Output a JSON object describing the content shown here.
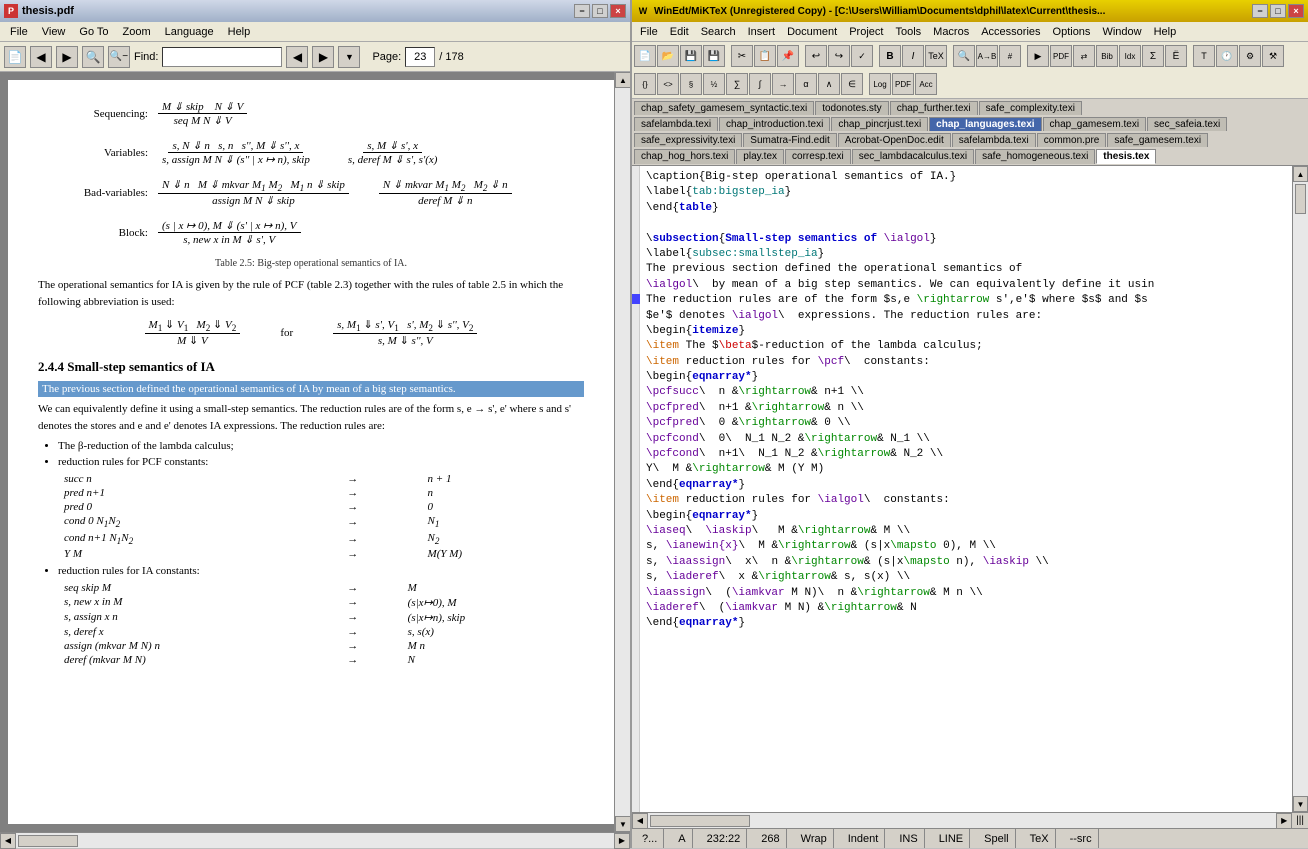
{
  "pdf": {
    "title": "thesis.pdf",
    "menu": [
      "File",
      "View",
      "Go To",
      "Zoom",
      "Language",
      "Help"
    ],
    "find_label": "Find:",
    "find_value": "",
    "page_current": "23",
    "page_total": "178",
    "window_controls": [
      "-",
      "□",
      "×"
    ],
    "caption": "Table 2.5: Big-step operational semantics of IA.",
    "body_text1": "The operational semantics for IA is given by the rule of PCF (table 2.3) together with the rules of table 2.5 in which the following abbreviation is used:",
    "section_heading": "2.4.4   Small-step semantics of IA",
    "highlight_text": "The previous section defined the operational semantics of IA by mean of a big step semantics.",
    "body_text2": "We can equivalently define it using a small-step semantics. The reduction rules are of the form s, e → s', e' where s and s' denotes the stores and e and e' denotes IA expressions. The reduction rules are:",
    "bullet1": "The β-reduction of the lambda calculus;",
    "bullet2": "reduction rules for PCF constants:",
    "bullet3": "reduction rules for IA constants:",
    "math_sequencing_top": "M ⇓ skip    N ⇓ V",
    "math_sequencing_bot": "seq M N ⇓ V",
    "math_var_top1": "s, N ⇓ n    s, n    s'',M ⇓ s'', x",
    "math_var_bot1": "s, assign M N ⇓ (s''|x ↦ n), skip",
    "math_var_top2": "s, M ⇓ s', x",
    "math_var_bot2": "s, deref M ⇓ s', s'(x)"
  },
  "editor": {
    "title": "WinEdt/MiKTeX (Unregistered Copy) - [C:\\Users\\William\\Documents\\dphil\\latex\\Current\\thesis...",
    "menu": [
      "File",
      "Edit",
      "Search",
      "Insert",
      "Document",
      "Project",
      "Tools",
      "Macros",
      "Accessories",
      "Options",
      "Window",
      "Help"
    ],
    "window_controls": [
      "-",
      "□",
      "×",
      "—",
      "□",
      "×"
    ],
    "tabs_row1": [
      "chap_safety_gamesem_syntactic.texi",
      "todonotes.sty",
      "chap_further.texi",
      "safe_complexity.texi"
    ],
    "tabs_row2": [
      "safelambda.texi",
      "chap_introduction.texi",
      "chap_pincrjust.texi",
      "chap_languages.texi",
      "chap_gamesem.texi",
      "sec_safeia.texi"
    ],
    "tabs_row3": [
      "safe_expressivity.texi",
      "Sumatra-Find.edit",
      "Acrobat-OpenDoc.edit",
      "safelambda.texi",
      "common.pre",
      "safe_gamesem.texi"
    ],
    "tabs_row4": [
      "chap_hog_hors.texi",
      "play.tex",
      "corresp.texi",
      "sec_lambdacalculus.texi",
      "safe_homogeneous.texi",
      "thesis.tex"
    ],
    "active_tab": "thesis.tex",
    "status_question": "?...",
    "status_col": "A",
    "status_pos": "232:22",
    "status_num": "268",
    "status_wrap": "Wrap",
    "status_indent": "Indent",
    "status_ins": "INS",
    "status_line": "LINE",
    "status_spell": "Spell",
    "status_tex": "TeX",
    "status_src": "--src",
    "code_lines": [
      "\\caption{Big-step operational semantics of IA.}",
      "\\label{tab:bigstep_ia}",
      "\\end{table}",
      "",
      "\\subsection{Small-step semantics of \\ialgol}",
      "\\label{subsec:smallstep_ia}",
      "The previous section defined the operational semantics of",
      "\\ialgol\\ by mean of a big step semantics. We can equivalently define it usin",
      "The reduction rules are of the form $s,e \\rightarrow s',e'$ where $s$ and $s",
      "$e'$ denotes \\ialgol\\ expressions. The reduction rules are:",
      "\\begin{itemize}",
      "\\item The $\\beta$-reduction of the lambda calculus;",
      "\\item reduction rules for \\pcf\\ constants:",
      "\\begin{eqnarray*}",
      "\\pcfsucc\\ n &\\rightarrow& n+1 \\\\",
      "\\pcfpred\\ n+1 &\\rightarrow& n \\\\",
      "\\pcfpred\\ 0 &\\rightarrow& 0 \\\\",
      "\\pcfcond\\ 0\\ N_1 N_2 &\\rightarrow& N_1 \\\\",
      "\\pcfcond\\ n+1\\ N_1 N_2 &\\rightarrow& N_2 \\\\",
      "Y\\ M &\\rightarrow& M (Y M)",
      "\\end{eqnarray*}",
      "\\item reduction rules for \\ialgol\\ constants:",
      "\\begin{eqnarray*}",
      "\\iaseq\\ \\iaskip\\  M &\\rightarrow& M \\\\",
      "s, \\ianewin{x}\\ M &\\rightarrow& (s|x\\mapsto 0), M \\\\",
      "s, \\iaassign\\ x\\ n &\\rightarrow& (s|x\\mapsto n), \\iaskip \\\\",
      "s, \\iaderef\\ x &\\rightarrow& s, s(x) \\\\",
      "\\iaassign\\ (\\iamkvar M N)\\ n &\\rightarrow& M n \\\\",
      "\\iaderef\\ (\\iamkvar M N) &\\rightarrow& N",
      "\\end{eqnarray*}"
    ]
  }
}
